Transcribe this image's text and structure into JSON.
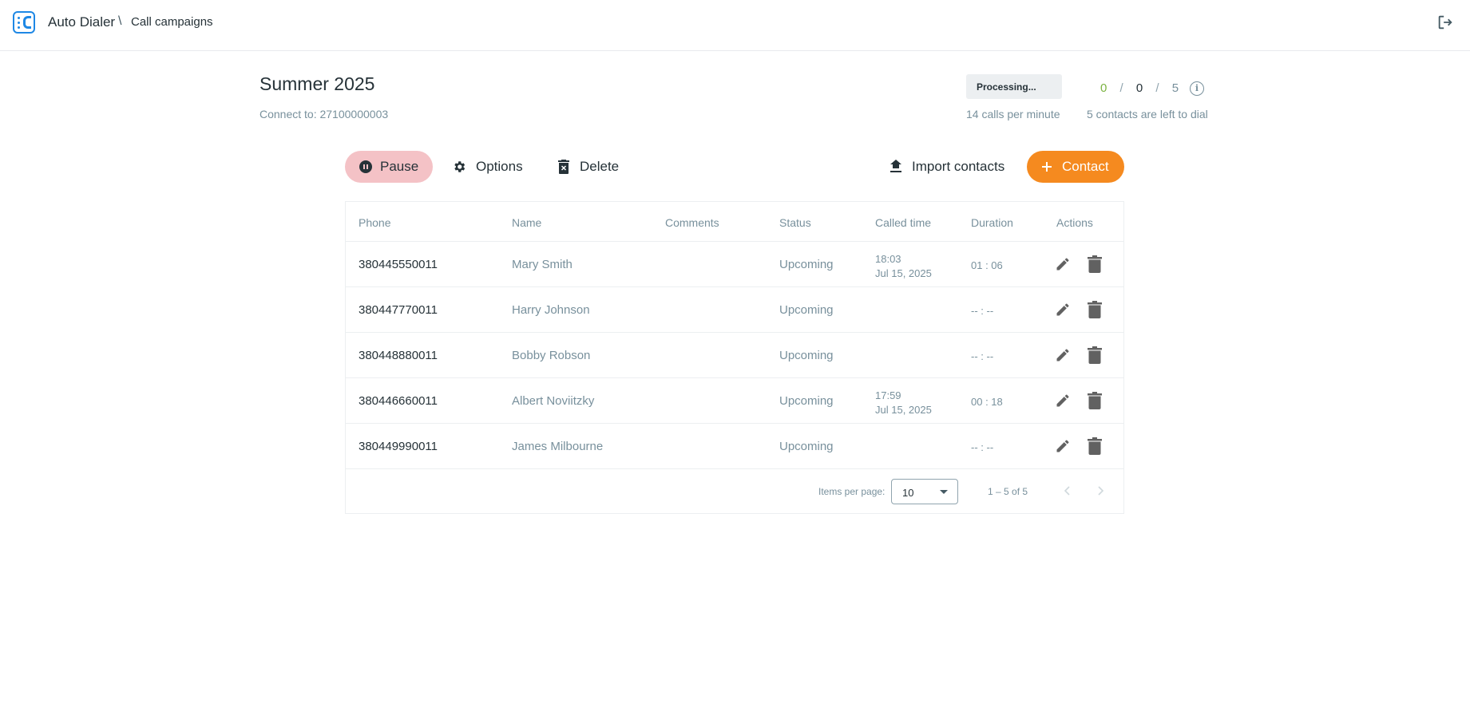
{
  "header": {
    "app_title": "Auto Dialer",
    "breadcrumb_separator": "\\",
    "breadcrumb": "Call campaigns",
    "logout_icon": "logout-icon"
  },
  "campaign": {
    "title": "Summer 2025",
    "connect_to": "Connect to: 27100000003",
    "status_badge": "Processing...",
    "calls_per_minute": "14 calls per minute",
    "counts": {
      "green": "0",
      "dark": "0",
      "total": "5",
      "separator": "/"
    },
    "contacts_left": "5 contacts are left to dial"
  },
  "actions": {
    "pause": "Pause",
    "options": "Options",
    "delete": "Delete",
    "import": "Import contacts",
    "contact": "Contact"
  },
  "table": {
    "columns": {
      "phone": "Phone",
      "name": "Name",
      "comments": "Comments",
      "status": "Status",
      "called_time": "Called time",
      "duration": "Duration",
      "actions": "Actions"
    },
    "rows": [
      {
        "phone": "380445550011",
        "name": "Mary Smith",
        "comments": "",
        "status": "Upcoming",
        "called_time": "18:03",
        "called_date": "Jul 15, 2025",
        "duration": "01 : 06"
      },
      {
        "phone": "380447770011",
        "name": "Harry Johnson",
        "comments": "",
        "status": "Upcoming",
        "called_time": "",
        "called_date": "",
        "duration": "-- : --"
      },
      {
        "phone": "380448880011",
        "name": "Bobby Robson",
        "comments": "",
        "status": "Upcoming",
        "called_time": "",
        "called_date": "",
        "duration": "-- : --"
      },
      {
        "phone": "380446660011",
        "name": "Albert Noviitzky",
        "comments": "",
        "status": "Upcoming",
        "called_time": "17:59",
        "called_date": "Jul 15, 2025",
        "duration": "00 : 18"
      },
      {
        "phone": "380449990011",
        "name": "James Milbourne",
        "comments": "",
        "status": "Upcoming",
        "called_time": "",
        "called_date": "",
        "duration": "-- : --"
      }
    ]
  },
  "paginator": {
    "items_per_page_label": "Items per page:",
    "items_per_page": "10",
    "range": "1 – 5 of 5"
  },
  "colors": {
    "brand": "#1e88e5",
    "pause_bg": "#f4c2c6",
    "contact_bg": "#f58a1f",
    "count_green": "#7cb342"
  }
}
